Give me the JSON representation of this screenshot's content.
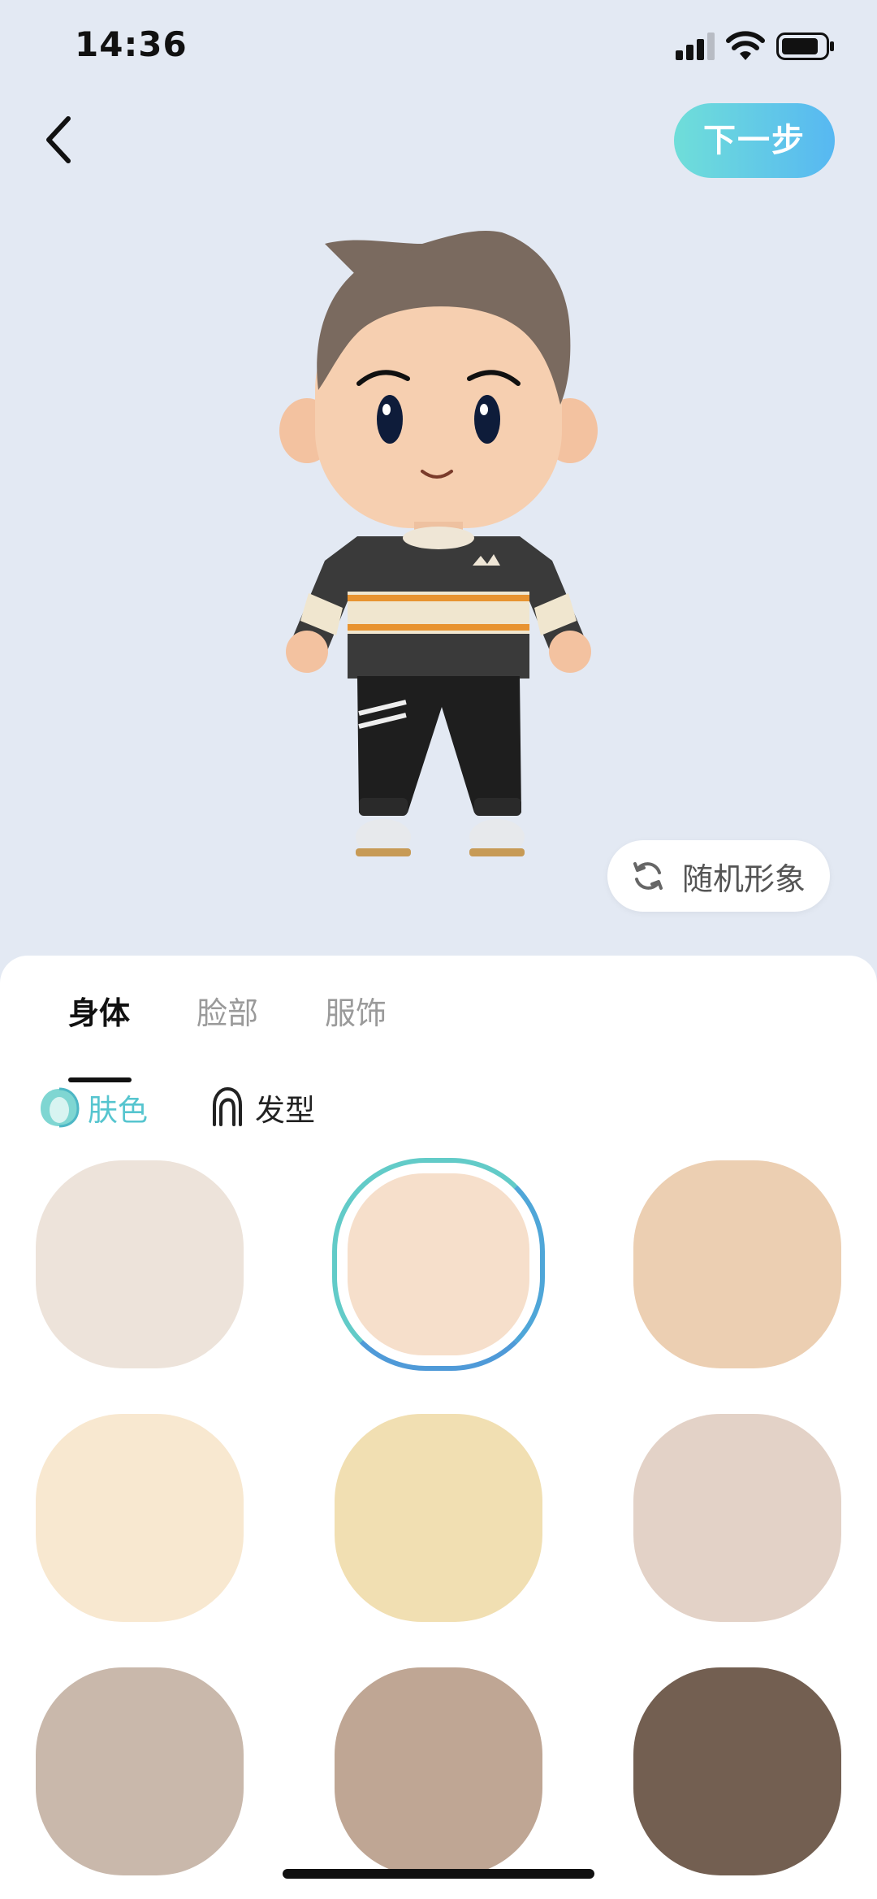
{
  "status": {
    "time": "14:36"
  },
  "header": {
    "next_label": "下一步"
  },
  "random": {
    "label": "随机形象"
  },
  "tabs": [
    {
      "label": "身体",
      "active": true
    },
    {
      "label": "脸部",
      "active": false
    },
    {
      "label": "服饰",
      "active": false
    }
  ],
  "subtabs": [
    {
      "label": "肤色",
      "icon": "skin-tone-icon",
      "active": true
    },
    {
      "label": "发型",
      "icon": "hairstyle-icon",
      "active": false
    }
  ],
  "swatches": [
    {
      "color": "#ede3da",
      "selected": false
    },
    {
      "color": "#f6dfcb",
      "selected": true
    },
    {
      "color": "#eccfb2",
      "selected": false
    },
    {
      "color": "#f8e8d0",
      "selected": false
    },
    {
      "color": "#f1dfb2",
      "selected": false
    },
    {
      "color": "#e3d2c7",
      "selected": false
    },
    {
      "color": "#c9b8ab",
      "selected": false
    },
    {
      "color": "#bfa694",
      "selected": false
    },
    {
      "color": "#735f51",
      "selected": false
    }
  ],
  "colors": {
    "accent": "#56c5cf",
    "background": "#e3e9f3"
  }
}
